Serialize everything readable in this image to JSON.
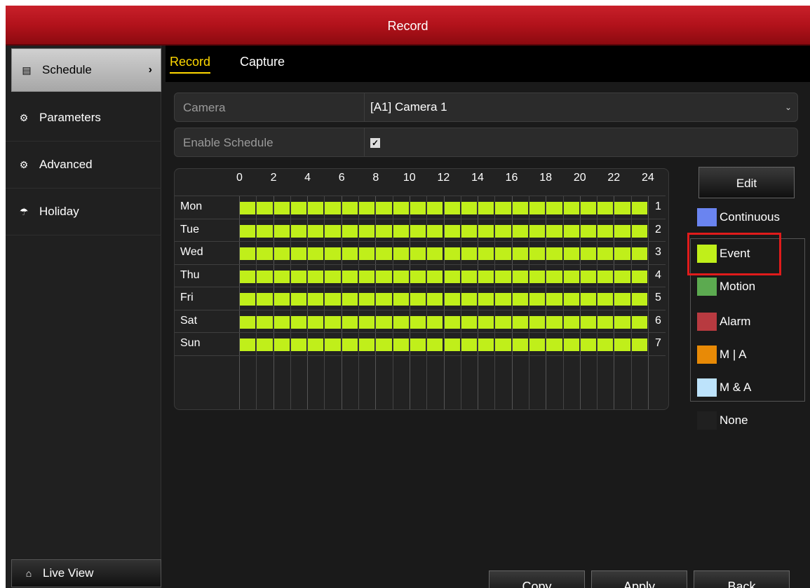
{
  "window": {
    "title": "Record"
  },
  "sidebar": {
    "items": [
      {
        "label": "Schedule",
        "icon": "schedule-icon"
      },
      {
        "label": "Parameters",
        "icon": "gear-icon"
      },
      {
        "label": "Advanced",
        "icon": "gears-icon"
      },
      {
        "label": "Holiday",
        "icon": "umbrella-icon"
      }
    ],
    "live_view": "Live View"
  },
  "tabs": {
    "record": "Record",
    "capture": "Capture"
  },
  "camera": {
    "label": "Camera",
    "value": "[A1] Camera 1"
  },
  "enable_schedule": {
    "label": "Enable Schedule",
    "checked": true
  },
  "schedule": {
    "hours": [
      "0",
      "2",
      "4",
      "6",
      "8",
      "10",
      "12",
      "14",
      "16",
      "18",
      "20",
      "22",
      "24"
    ],
    "days": [
      "Mon",
      "Tue",
      "Wed",
      "Thu",
      "Fri",
      "Sat",
      "Sun"
    ],
    "row_numbers": [
      "1",
      "2",
      "3",
      "4",
      "5",
      "6",
      "7"
    ],
    "mode_per_day": "Event",
    "segments_per_day": 24
  },
  "edit_button": "Edit",
  "legend": [
    {
      "label": "Continuous",
      "color": "#6a84f0"
    },
    {
      "label": "Event",
      "color": "#c0ef1a"
    },
    {
      "label": "Motion",
      "color": "#5caa50"
    },
    {
      "label": "Alarm",
      "color": "#b83a40"
    },
    {
      "label": "M | A",
      "color": "#e88a06"
    },
    {
      "label": "M & A",
      "color": "#bde3fb"
    },
    {
      "label": "None",
      "color": "#202020"
    }
  ],
  "buttons": {
    "copy": "Copy",
    "apply": "Apply",
    "back": "Back"
  }
}
